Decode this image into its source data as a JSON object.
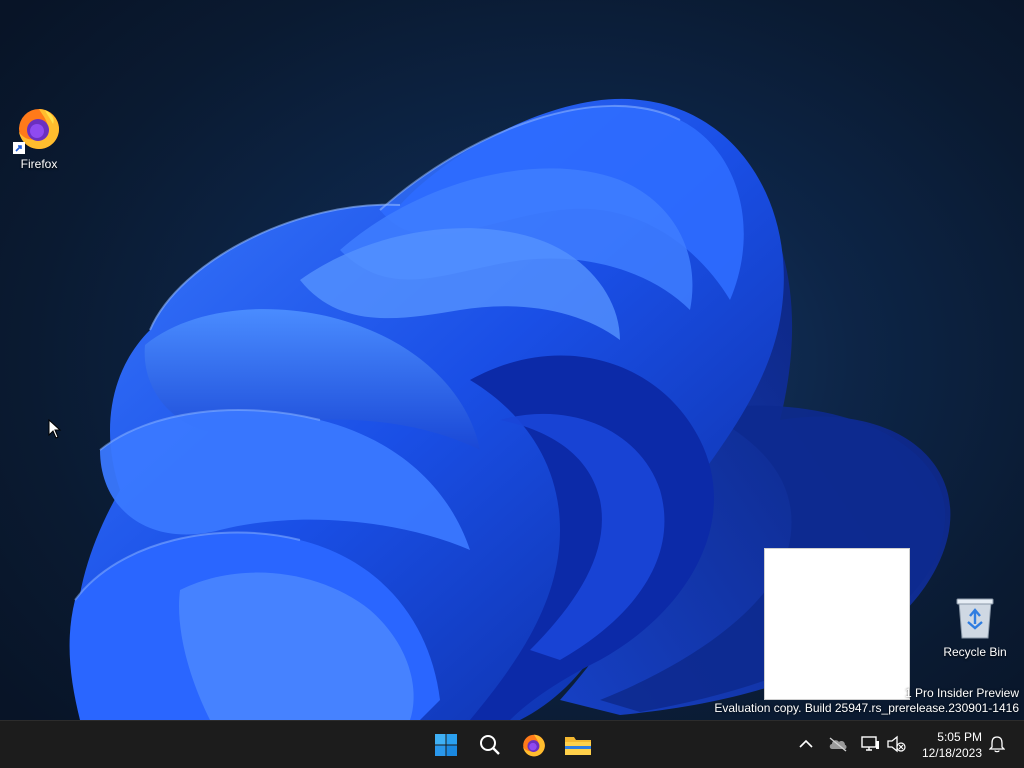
{
  "desktop": {
    "icons": [
      {
        "label": "Firefox",
        "icon": "firefox-icon"
      },
      {
        "label": "Recycle Bin",
        "icon": "recycle-bin-icon"
      }
    ],
    "watermark": {
      "line1": "1 Pro Insider Preview",
      "line2": "Evaluation copy. Build 25947.rs_prerelease.230901-1416"
    }
  },
  "taskbar": {
    "apps": [
      {
        "name": "Start",
        "icon": "windows-start-icon"
      },
      {
        "name": "Search",
        "icon": "search-icon"
      },
      {
        "name": "Firefox",
        "icon": "firefox-icon"
      },
      {
        "name": "File Explorer",
        "icon": "folder-icon"
      }
    ],
    "tray": {
      "icons": [
        "chevron-up-icon",
        "onedrive-offline-icon",
        "network-icon",
        "volume-muted-icon",
        "notification-bell-icon"
      ],
      "time": "5:05 PM",
      "date": "12/18/2023"
    }
  },
  "colors": {
    "wallpaper_bg": "#0a1a30",
    "bloom_blue": "#1f5cf0",
    "taskbar": "#1c1c1c",
    "start_blue": "#2a9ff0"
  }
}
